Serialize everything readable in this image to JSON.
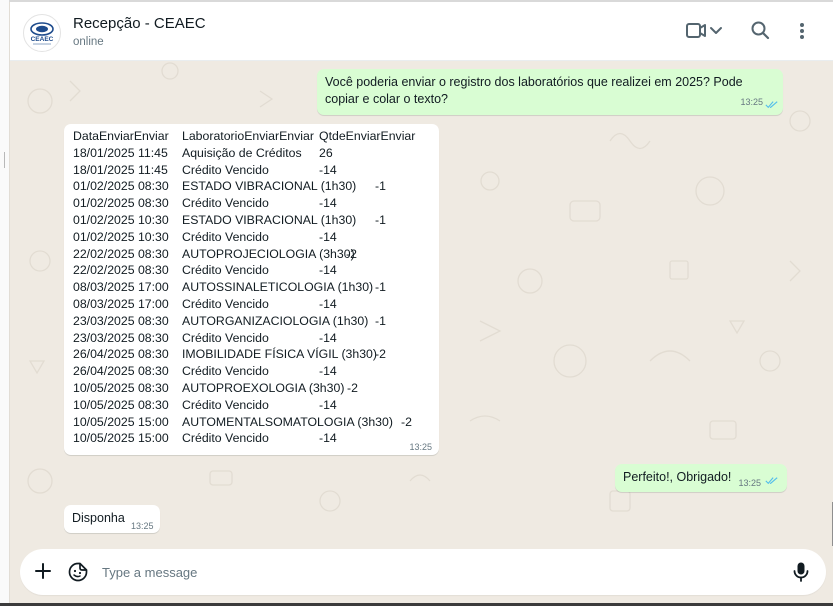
{
  "header": {
    "contact_name": "Recepção - CEAEC",
    "status": "online",
    "avatar_text": "CEAEC",
    "icons": [
      "video-call-icon",
      "chevron-down-icon",
      "search-icon",
      "kebab-menu-icon"
    ]
  },
  "messages": {
    "m1": {
      "direction": "outgoing",
      "text": "Você poderia enviar o registro dos laboratórios que realizei em 2025? Pode copiar e colar o texto?",
      "time": "13:25",
      "status": "read"
    },
    "m2": {
      "direction": "incoming",
      "header": [
        "DataEnviarEnviar",
        "LaboratorioEnviarEnviar",
        "QtdeEnviarEnviar"
      ],
      "rows": [
        [
          "18/01/2025 11:45",
          "Aquisição de Créditos",
          "26"
        ],
        [
          "18/01/2025 11:45",
          "Crédito Vencido",
          "-14"
        ],
        [
          "01/02/2025 08:30",
          "ESTADO VIBRACIONAL (1h30)",
          "-1"
        ],
        [
          "01/02/2025 08:30",
          "Crédito Vencido",
          "-14"
        ],
        [
          "01/02/2025 10:30",
          "ESTADO VIBRACIONAL (1h30)",
          "-1"
        ],
        [
          "01/02/2025 10:30",
          "Crédito Vencido",
          "-14"
        ],
        [
          "22/02/2025 08:30",
          "AUTOPROJECIOLOGIA (3h30)",
          "-2"
        ],
        [
          "22/02/2025 08:30",
          "Crédito Vencido",
          "-14"
        ],
        [
          "08/03/2025 17:00",
          "AUTOSSINALETICOLOGIA (1h30)",
          "-1"
        ],
        [
          "08/03/2025 17:00",
          "Crédito Vencido",
          "-14"
        ],
        [
          "23/03/2025 08:30",
          "AUTORGANIZACIOLOGIA (1h30)",
          "-1"
        ],
        [
          "23/03/2025 08:30",
          "Crédito Vencido",
          "-14"
        ],
        [
          "26/04/2025 08:30",
          "IMOBILIDADE FÍSICA VÍGIL (3h30)",
          "-2"
        ],
        [
          "26/04/2025 08:30",
          "Crédito Vencido",
          "-14"
        ],
        [
          "10/05/2025 08:30",
          "AUTOPROEXOLOGIA (3h30)",
          "-2"
        ],
        [
          "10/05/2025 08:30",
          "Crédito Vencido",
          "-14"
        ],
        [
          "10/05/2025 15:00",
          "AUTOMENTALSOMATOLOGIA (3h30)",
          "-2"
        ],
        [
          "10/05/2025 15:00",
          "Crédito Vencido",
          "-14"
        ]
      ],
      "time": "13:25"
    },
    "m3": {
      "direction": "outgoing",
      "text": "Perfeito!, Obrigado!",
      "time": "13:25",
      "status": "read"
    },
    "m4": {
      "direction": "incoming",
      "text": "Disponha",
      "time": "13:25"
    }
  },
  "composer": {
    "placeholder": "Type a message",
    "value": "",
    "icons": [
      "plus-icon",
      "sticker-icon",
      "microphone-icon"
    ]
  },
  "colors": {
    "chat_bg": "#efeae2",
    "outgoing_bubble": "#d9fdd3",
    "incoming_bubble": "#ffffff",
    "read_ticks": "#53bdeb",
    "icon": "#54656f"
  }
}
